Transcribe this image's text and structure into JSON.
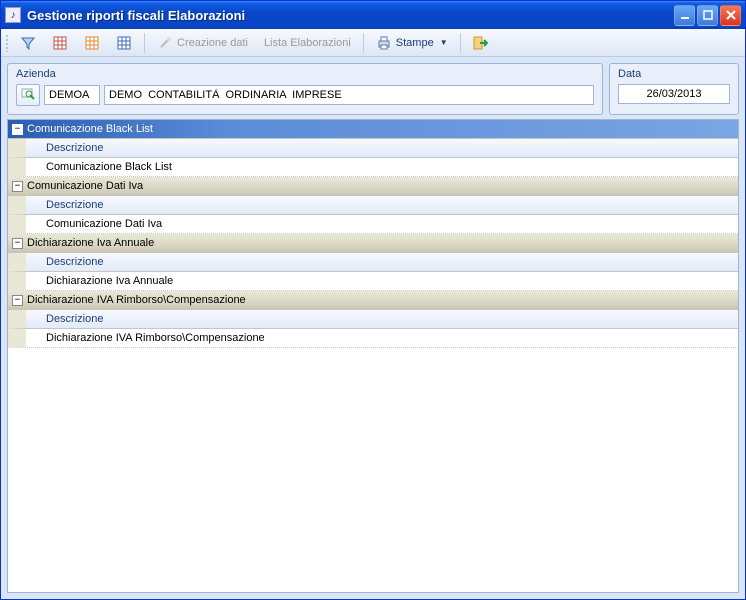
{
  "window": {
    "title": "Gestione riporti fiscali Elaborazioni"
  },
  "toolbar": {
    "creazione_dati": "Creazione dati",
    "lista_elaborazioni": "Lista Elaborazioni",
    "stampe": "Stampe"
  },
  "group_labels": {
    "azienda": "Azienda",
    "data": "Data"
  },
  "azienda": {
    "code": "DEMOA",
    "descrizione": "DEMO  CONTABILITÀ  ORDINARIA  IMPRESE"
  },
  "data": {
    "value": "26/03/2013"
  },
  "grid": {
    "field_label": "Descrizione",
    "groups": [
      {
        "title": "Comunicazione Black List",
        "value": "Comunicazione Black List",
        "selected": true
      },
      {
        "title": "Comunicazione Dati Iva",
        "value": "Comunicazione Dati Iva",
        "selected": false
      },
      {
        "title": "Dichiarazione Iva Annuale",
        "value": "Dichiarazione Iva Annuale",
        "selected": false
      },
      {
        "title": "Dichiarazione  IVA  Rimborso\\Compensazione",
        "value": "Dichiarazione  IVA  Rimborso\\Compensazione",
        "selected": false
      }
    ]
  },
  "icons": {
    "funnel": "funnel-icon",
    "grid_red": "grid-red-icon",
    "grid_orange": "grid-orange-icon",
    "grid_blue": "grid-blue-icon",
    "wand": "wand-icon",
    "printer": "printer-icon",
    "exit": "exit-icon",
    "lookup": "lookup-icon"
  }
}
